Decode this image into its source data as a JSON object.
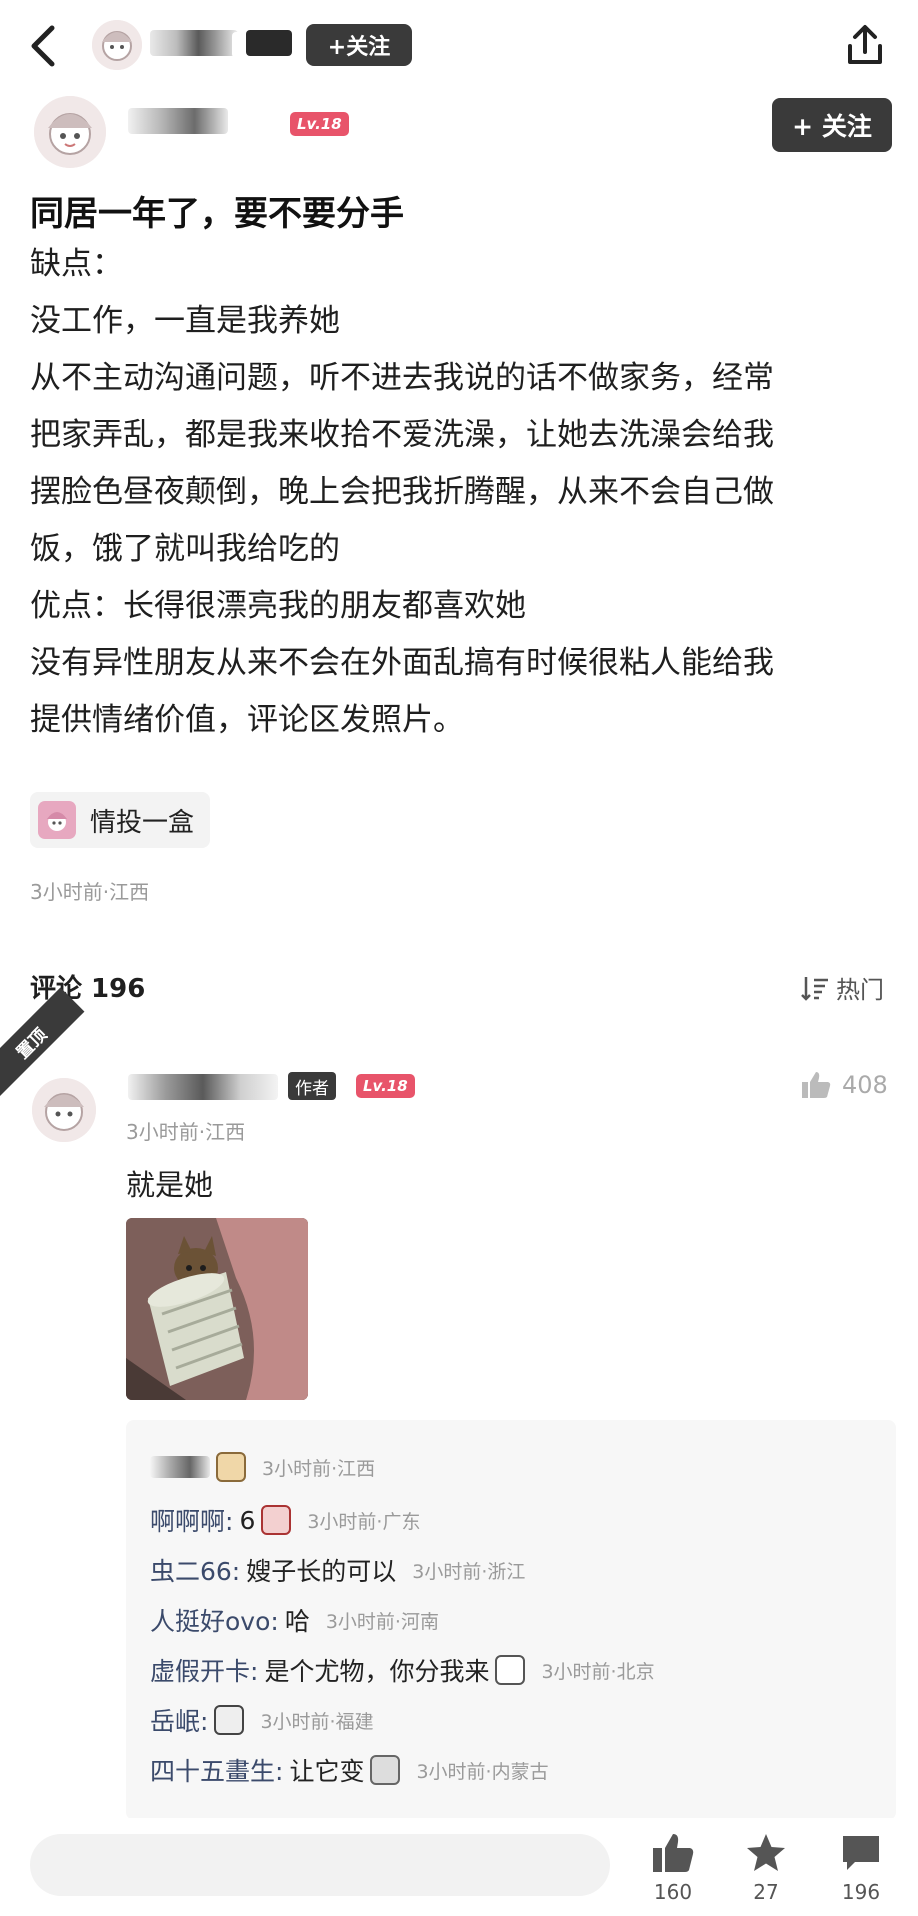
{
  "nav": {
    "follow_label": "+关注"
  },
  "author": {
    "level": "Lv.18",
    "follow_label": "+ 关注"
  },
  "post": {
    "title": "同居一年了，要不要分手",
    "body_lines": [
      "缺点：",
      "没工作，一直是我养她",
      "从不主动沟通问题，听不进去我说的话不做家务，经常",
      "把家弄乱，都是我来收拾不爱洗澡，让她去洗澡会给我",
      "摆脸色昼夜颠倒，晚上会把我折腾醒，从来不会自己做",
      "饭，饿了就叫我给吃的",
      "优点：长得很漂亮我的朋友都喜欢她",
      "没有异性朋友从来不会在外面乱搞有时候很粘人能给我",
      "提供情绪价值，评论区发照片。"
    ],
    "tag": "情投一盒",
    "meta": "3小时前·江西"
  },
  "comments": {
    "header": "评论 196",
    "sort_label": "热门",
    "pinned_label": "置顶",
    "top_comment": {
      "author_badge": "作者",
      "level": "Lv.18",
      "likes": "408",
      "time": "3小时前·江西",
      "text": "就是她"
    },
    "replies": [
      {
        "who": "",
        "text": "",
        "time": "3小时前·江西"
      },
      {
        "who": "啊啊啊:",
        "text": "6",
        "time": "3小时前·广东"
      },
      {
        "who": "虫二66:",
        "text": "嫂子长的可以",
        "time": "3小时前·浙江"
      },
      {
        "who": "人挺好ovo:",
        "text": "哈",
        "time": "3小时前·河南"
      },
      {
        "who": "虚假开卡:",
        "text": "是个尤物，你分我来",
        "time": "3小时前·北京"
      },
      {
        "who": "岳岷:",
        "text": "",
        "time": "3小时前·福建"
      },
      {
        "who": "四十五畫生:",
        "text": "让它变",
        "time": "3小时前·内蒙古"
      }
    ]
  },
  "bottom": {
    "likes": "160",
    "stars": "27",
    "comments": "196"
  }
}
